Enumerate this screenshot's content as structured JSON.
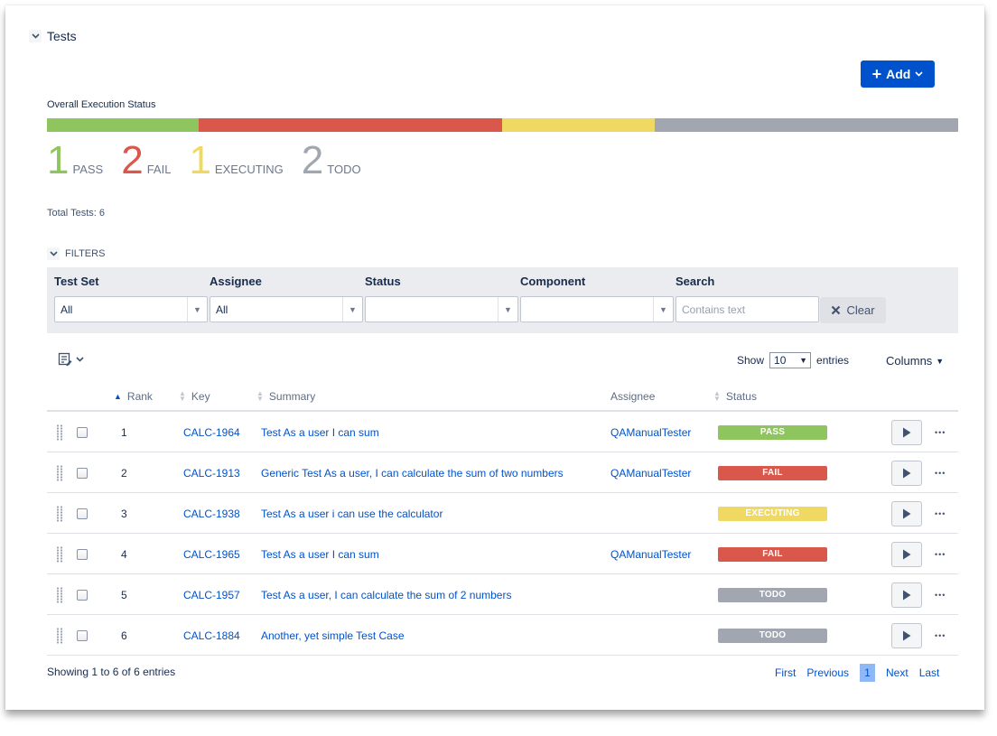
{
  "section": {
    "title": "Tests"
  },
  "add_button": {
    "label": "Add"
  },
  "execution_status": {
    "label": "Overall Execution Status",
    "segments": [
      {
        "name": "PASS",
        "count": 1,
        "color": "#8fc55e"
      },
      {
        "name": "FAIL",
        "count": 2,
        "color": "#d9574b"
      },
      {
        "name": "EXECUTING",
        "count": 1,
        "color": "#efd962"
      },
      {
        "name": "TODO",
        "count": 2,
        "color": "#a1a6b1"
      }
    ],
    "counts": [
      {
        "num": "1",
        "label": "PASS",
        "color": "#8fc55e"
      },
      {
        "num": "2",
        "label": "FAIL",
        "color": "#d9574b"
      },
      {
        "num": "1",
        "label": "EXECUTING",
        "color": "#efd962"
      },
      {
        "num": "2",
        "label": "TODO",
        "color": "#a1a6b1"
      }
    ]
  },
  "total_tests": "Total Tests: 6",
  "filters": {
    "toggle_label": "FILTERS",
    "test_set": {
      "label": "Test Set",
      "value": "All"
    },
    "assignee": {
      "label": "Assignee",
      "value": "All"
    },
    "status": {
      "label": "Status",
      "value": ""
    },
    "component": {
      "label": "Component",
      "value": ""
    },
    "search": {
      "label": "Search",
      "placeholder": "Contains text",
      "value": ""
    },
    "clear_label": "Clear"
  },
  "table": {
    "show_label": "Show",
    "page_size": "10",
    "entries_label": "entries",
    "columns_label": "Columns",
    "headers": {
      "rank": "Rank",
      "key": "Key",
      "summary": "Summary",
      "assignee": "Assignee",
      "status": "Status"
    },
    "rows": [
      {
        "rank": "1",
        "key": "CALC-1964",
        "summary": "Test As a user I can sum",
        "assignee": "QAManualTester",
        "status": "PASS",
        "status_color": "#8fc55e"
      },
      {
        "rank": "2",
        "key": "CALC-1913",
        "summary": "Generic Test As a user, I can calculate the sum of two numbers",
        "assignee": "QAManualTester",
        "status": "FAIL",
        "status_color": "#d9574b"
      },
      {
        "rank": "3",
        "key": "CALC-1938",
        "summary": "Test As a user i can use the calculator",
        "assignee": "",
        "status": "EXECUTING",
        "status_color": "#efd962"
      },
      {
        "rank": "4",
        "key": "CALC-1965",
        "summary": "Test As a user I can sum",
        "assignee": "QAManualTester",
        "status": "FAIL",
        "status_color": "#d9574b"
      },
      {
        "rank": "5",
        "key": "CALC-1957",
        "summary": "Test As a user, I can calculate the sum of 2 numbers",
        "assignee": "",
        "status": "TODO",
        "status_color": "#a1a6b1"
      },
      {
        "rank": "6",
        "key": "CALC-1884",
        "summary": "Another, yet simple Test Case",
        "assignee": "",
        "status": "TODO",
        "status_color": "#a1a6b1"
      }
    ],
    "showing": "Showing 1 to 6 of 6 entries"
  },
  "pagination": {
    "first": "First",
    "previous": "Previous",
    "current": "1",
    "next": "Next",
    "last": "Last"
  }
}
